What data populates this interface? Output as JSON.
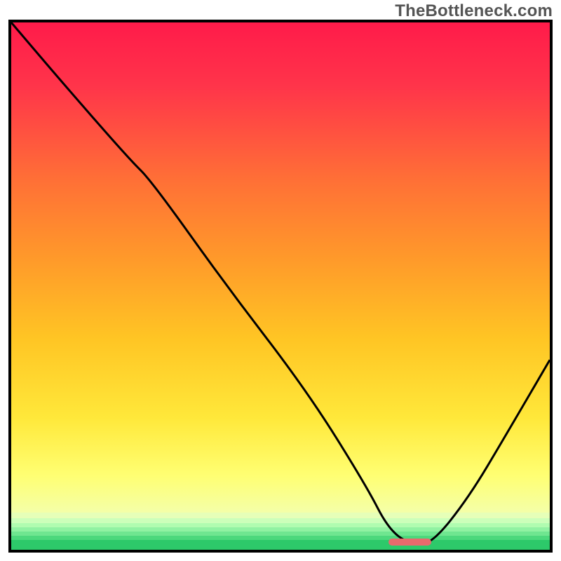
{
  "watermark": "TheBottleneck.com",
  "chart_data": {
    "type": "line",
    "title": "",
    "xlabel": "",
    "ylabel": "",
    "x_range": [
      0,
      100
    ],
    "y_range": [
      0,
      100
    ],
    "background_gradient": {
      "stops": [
        {
          "pct": 0,
          "color": "#ff1b4a"
        },
        {
          "pct": 12,
          "color": "#ff344a"
        },
        {
          "pct": 30,
          "color": "#ff7036"
        },
        {
          "pct": 45,
          "color": "#ff9a2a"
        },
        {
          "pct": 60,
          "color": "#ffc524"
        },
        {
          "pct": 75,
          "color": "#ffe83a"
        },
        {
          "pct": 86,
          "color": "#ffff73"
        },
        {
          "pct": 93,
          "color": "#f4ffa8"
        }
      ],
      "height_pct": 93
    },
    "bands": [
      {
        "top_pct": 93.0,
        "height_pct": 1.0,
        "color": "#e6ffb8"
      },
      {
        "top_pct": 94.0,
        "height_pct": 0.9,
        "color": "#ccffba"
      },
      {
        "top_pct": 94.9,
        "height_pct": 0.8,
        "color": "#b0fcb0"
      },
      {
        "top_pct": 95.7,
        "height_pct": 0.8,
        "color": "#90f2a2"
      },
      {
        "top_pct": 96.5,
        "height_pct": 0.8,
        "color": "#6fe690"
      },
      {
        "top_pct": 97.3,
        "height_pct": 0.8,
        "color": "#4cd87c"
      },
      {
        "top_pct": 98.1,
        "height_pct": 1.9,
        "color": "#2dc96a"
      }
    ],
    "series": [
      {
        "name": "bottleneck-curve",
        "color": "#000000",
        "x": [
          0,
          10,
          22,
          26,
          40,
          55,
          66,
          70,
          74,
          78,
          85,
          92,
          100
        ],
        "y": [
          100,
          88,
          74,
          70,
          50,
          30,
          12,
          4,
          1,
          1,
          10,
          22,
          36
        ]
      }
    ],
    "marker": {
      "x_start_pct": 70,
      "x_end_pct": 78,
      "y_pct": 98.6,
      "color": "#e86a6d"
    },
    "annotations": []
  }
}
